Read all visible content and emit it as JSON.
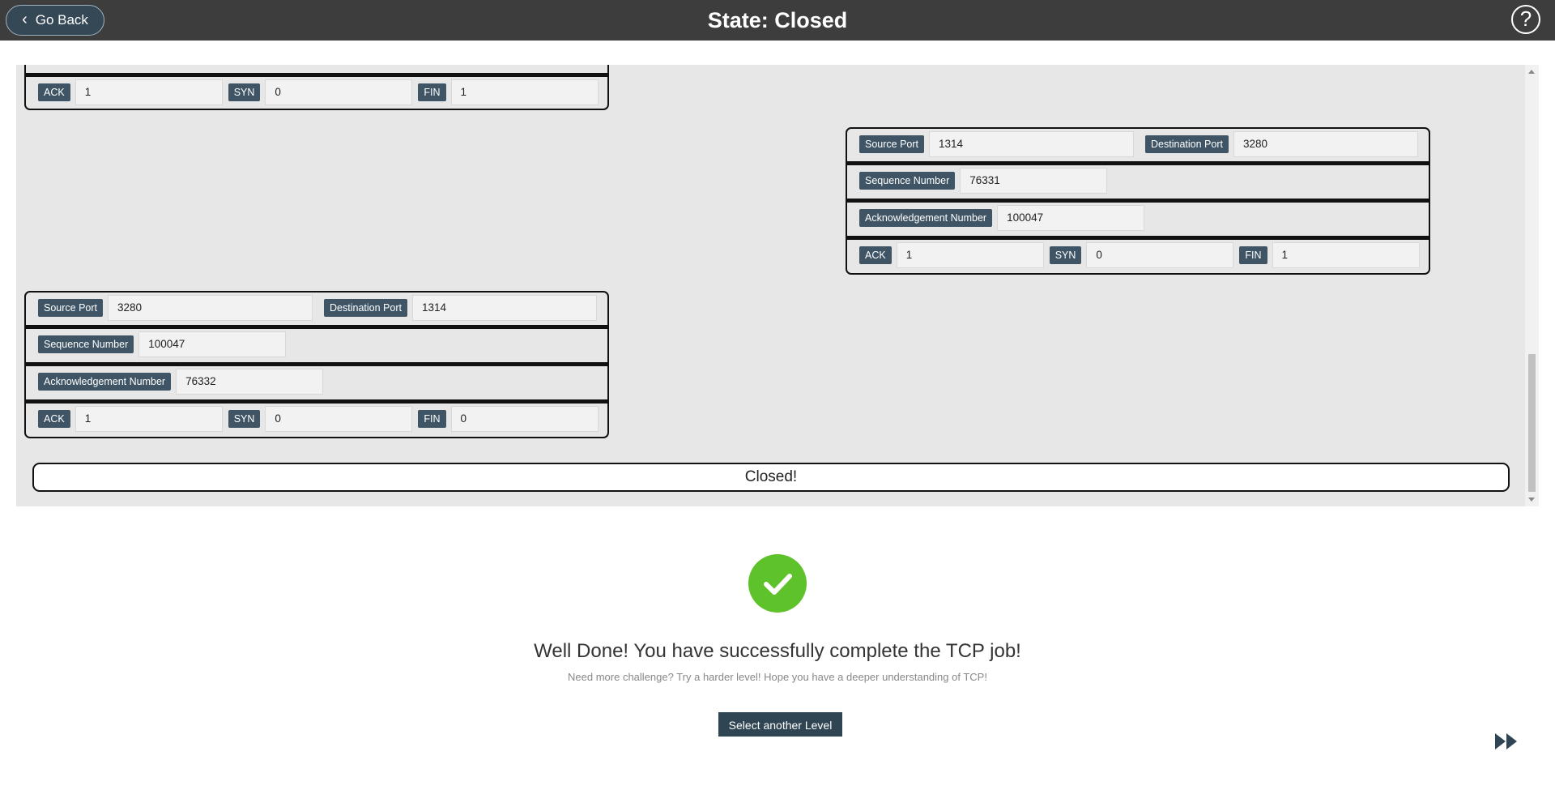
{
  "header": {
    "back_label": "Go Back",
    "title": "State: Closed",
    "help_symbol": "?"
  },
  "packets": {
    "top_partial": {
      "ack_label": "ACK",
      "ack_value": "1",
      "syn_label": "SYN",
      "syn_value": "0",
      "fin_label": "FIN",
      "fin_value": "1"
    },
    "right": {
      "source_port_label": "Source Port",
      "source_port": "1314",
      "dest_port_label": "Destination Port",
      "dest_port": "3280",
      "seq_label": "Sequence Number",
      "seq_value": "76331",
      "ack_num_label": "Acknowledgement Number",
      "ack_num_value": "100047",
      "ack_label": "ACK",
      "ack_value": "1",
      "syn_label": "SYN",
      "syn_value": "0",
      "fin_label": "FIN",
      "fin_value": "1"
    },
    "bottom_left": {
      "source_port_label": "Source Port",
      "source_port": "3280",
      "dest_port_label": "Destination Port",
      "dest_port": "1314",
      "seq_label": "Sequence Number",
      "seq_value": "100047",
      "ack_num_label": "Acknowledgement Number",
      "ack_num_value": "76332",
      "ack_label": "ACK",
      "ack_value": "1",
      "syn_label": "SYN",
      "syn_value": "0",
      "fin_label": "FIN",
      "fin_value": "0"
    }
  },
  "status": {
    "closed_text": "Closed!"
  },
  "success": {
    "icon": "checkmark-icon",
    "title": "Well Done! You have successfully complete the TCP job!",
    "subtitle": "Need more challenge? Try a harder level! Hope you have a deeper understanding of TCP!",
    "button_label": "Select another Level",
    "accent_color": "#5ec22a"
  },
  "colors": {
    "header_bg": "#3d3d3d",
    "label_bg": "#3f5565",
    "button_bg": "#2f4553",
    "panel_bg": "#e7e7e7"
  }
}
